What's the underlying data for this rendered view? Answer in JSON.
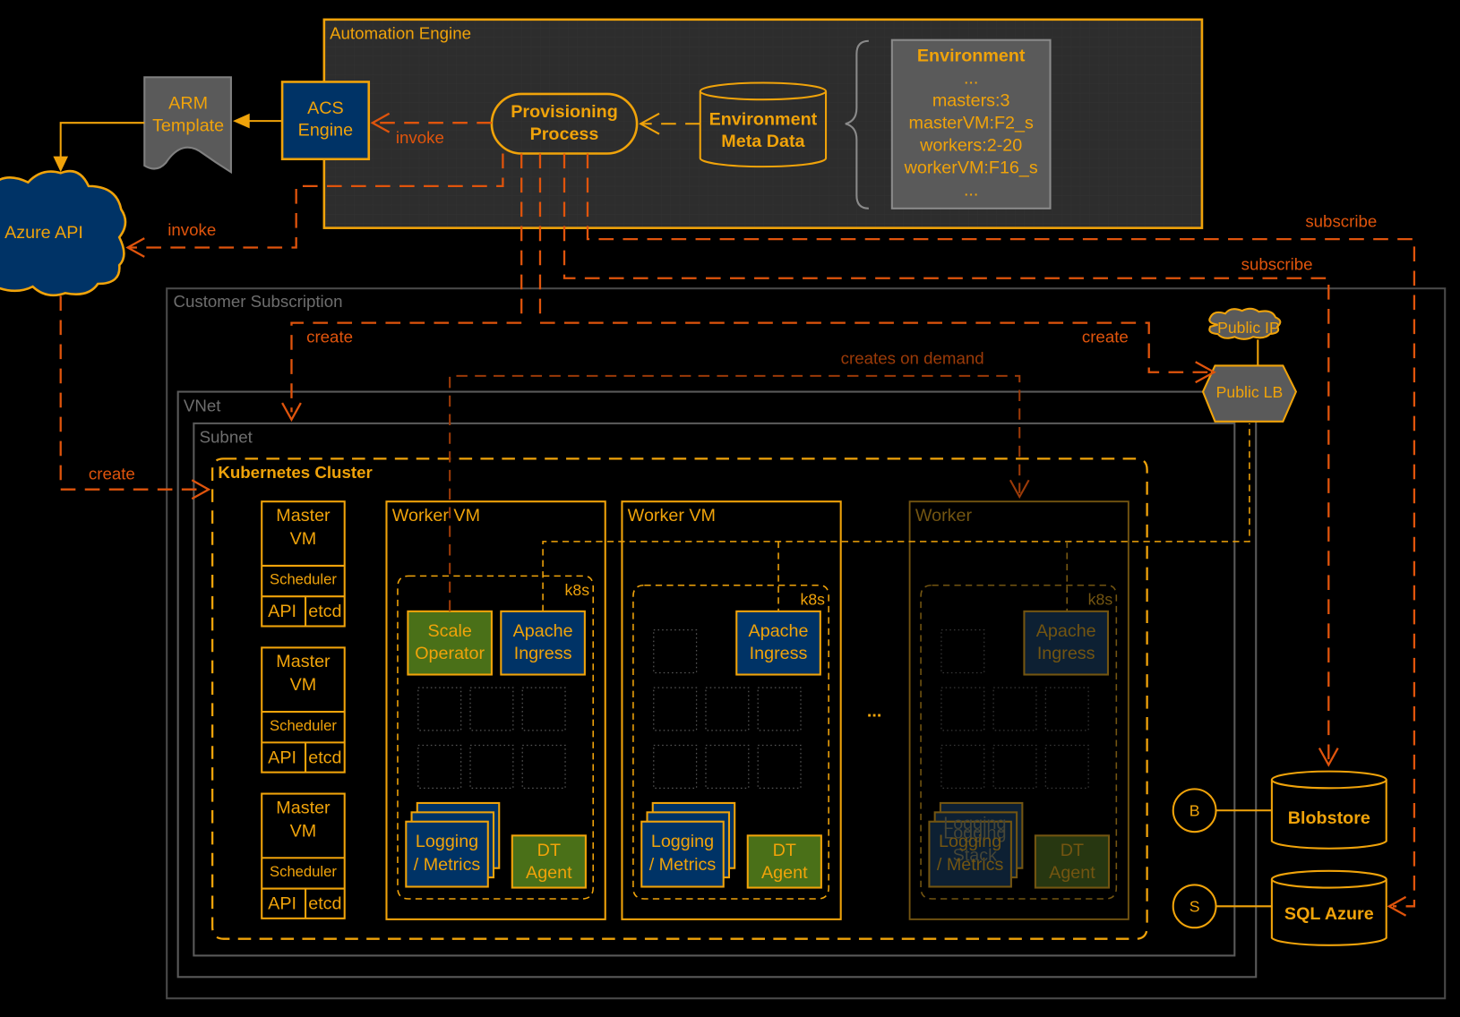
{
  "colors": {
    "background": "#000000",
    "accent": "#f0a30a",
    "edge": "#e0540c",
    "blue_box": "#003366",
    "green_box": "#4a7018",
    "gray_panel": "#2d2d2d",
    "gray_box": "#5a5a5a"
  },
  "automation_engine": {
    "title": "Automation Engine",
    "acs_engine": [
      "ACS",
      "Engine"
    ],
    "provisioning_process": [
      "Provisioning",
      "Process"
    ],
    "env_meta_data": [
      "Environment",
      "Meta Data"
    ],
    "environment_note": {
      "title": "Environment",
      "lines": [
        "...",
        "masters:3",
        "masterVM:F2_s",
        "workers:2-20",
        "workerVM:F16_s",
        "..."
      ]
    }
  },
  "arm_template": [
    "ARM",
    "Template"
  ],
  "azure_api": "Azure API",
  "edges": {
    "invoke_acs": "invoke",
    "invoke_azure": "invoke",
    "subscribe_1": "subscribe",
    "subscribe_2": "subscribe",
    "create_cluster": "create",
    "create_lb": "create",
    "create_azure": "create",
    "creates_on_demand": "creates on demand"
  },
  "customer_subscription": {
    "title": "Customer Subscription",
    "vnet": "VNet",
    "subnet": "Subnet",
    "public_ip": "Public IP",
    "public_lb": "Public LB"
  },
  "cluster": {
    "title": "Kubernetes Cluster",
    "masters": [
      {
        "title": [
          "Master",
          "VM"
        ],
        "scheduler": "Scheduler",
        "api": "API",
        "etcd": "etcd"
      },
      {
        "title": [
          "Master",
          "VM"
        ],
        "scheduler": "Scheduler",
        "api": "API",
        "etcd": "etcd"
      },
      {
        "title": [
          "Master",
          "VM"
        ],
        "scheduler": "Scheduler",
        "api": "API",
        "etcd": "etcd"
      }
    ],
    "workers": [
      {
        "title": "Worker VM",
        "k8s": "k8s",
        "scale_operator": [
          "Scale",
          "Operator"
        ],
        "ingress": [
          "Apache",
          "Ingress"
        ],
        "logging": [
          "Logging",
          "/ Metrics"
        ],
        "dt_agent": [
          "DT",
          "Agent"
        ]
      },
      {
        "title": "Worker VM",
        "k8s": "k8s",
        "ingress": [
          "Apache",
          "Ingress"
        ],
        "logging": [
          "Logging",
          "/ Metrics"
        ],
        "dt_agent": [
          "DT",
          "Agent"
        ]
      },
      {
        "title": "Worker",
        "k8s": "k8s",
        "ingress": [
          "Apache",
          "Ingress"
        ],
        "logging": [
          "Logging",
          "/ Metrics"
        ],
        "logging_ghost": [
          "Logging",
          "Logging",
          "Stack"
        ],
        "dt_agent": [
          "DT",
          "Agent"
        ]
      }
    ],
    "ellipsis": "..."
  },
  "storage": {
    "blob_badge": "B",
    "blobstore": "Blobstore",
    "sql_badge": "S",
    "sql_azure": "SQL Azure"
  }
}
